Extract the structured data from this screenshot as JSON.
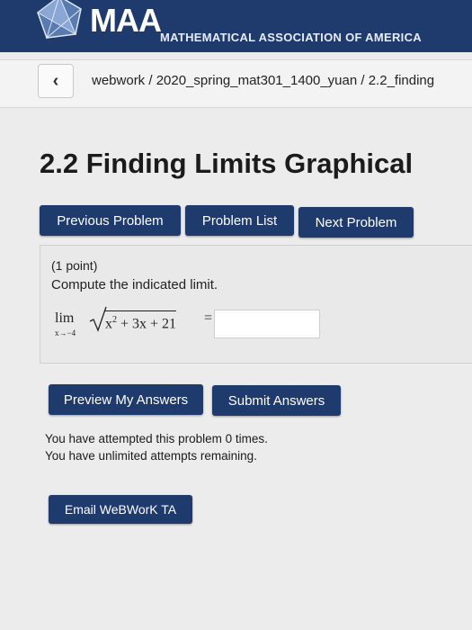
{
  "header": {
    "logo_text": "MAA",
    "org_name": "MATHEMATICAL ASSOCIATION OF AMERICA"
  },
  "breadcrumb": {
    "back_label": "‹",
    "path": "webwork / 2020_spring_mat301_1400_yuan / 2.2_finding"
  },
  "page": {
    "title": "2.2 Finding Limits Graphical"
  },
  "nav": {
    "previous": "Previous Problem",
    "list": "Problem List",
    "next": "Next Problem"
  },
  "problem": {
    "points": "(1 point)",
    "prompt": "Compute the indicated limit.",
    "math": {
      "lim": "lim",
      "subscript": "x→−4",
      "x": "x",
      "exponent": "2",
      "rest": " + 3x + 21",
      "equals": "="
    },
    "answer_value": ""
  },
  "actions": {
    "preview": "Preview My Answers",
    "submit": "Submit Answers"
  },
  "status": {
    "attempts": "You have attempted this problem 0 times.",
    "remaining": "You have unlimited attempts remaining."
  },
  "email_ta": "Email WeBWorK TA",
  "colors": {
    "header_bg": "#1f3a6d",
    "button_bg": "#1f3a6d",
    "page_bg": "#ececec"
  }
}
